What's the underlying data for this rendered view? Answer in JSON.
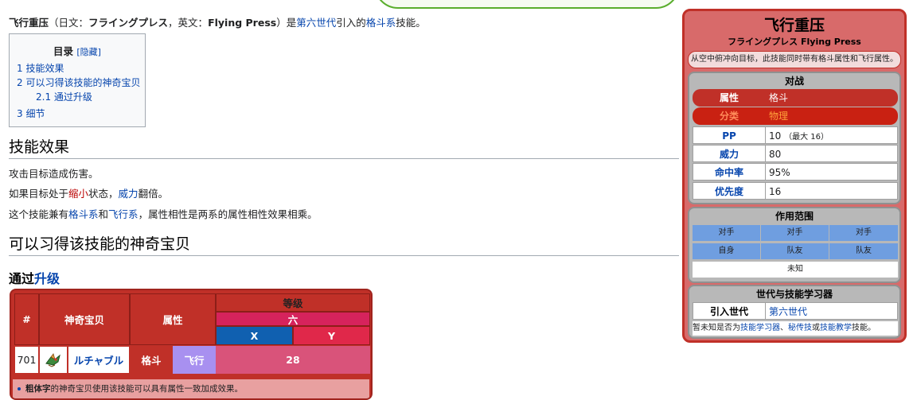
{
  "intro": {
    "title": "飞行重压",
    "paren_open": "（日文：",
    "jp_name": "フライングプレス",
    "en_label": "，英文：",
    "en_name": "Flying Press",
    "paren_close": "）是",
    "gen_link": "第六世代",
    "mid": "引入的",
    "type_link": "格斗系",
    "end": "技能。"
  },
  "toc": {
    "title": "目录",
    "toggle": "[隐藏]",
    "items": [
      "1 技能效果",
      "2 可以习得该技能的神奇宝贝",
      "2.1 通过升级",
      "3 细节"
    ]
  },
  "sections": {
    "effect_heading": "技能效果",
    "effect_p1": "攻击目标造成伤害。",
    "effect_p2_a": "如果目标处于",
    "effect_p2_link1": "缩小",
    "effect_p2_b": "状态，",
    "effect_p2_link2": "威力",
    "effect_p2_c": "翻倍。",
    "effect_p3_a": "这个技能兼有",
    "effect_p3_link1": "格斗系",
    "effect_p3_b": "和",
    "effect_p3_link2": "飞行系",
    "effect_p3_c": "，属性相性是两系的属性相性效果相乘。",
    "learn_heading": "可以习得该技能的神奇宝贝",
    "levelup_heading_a": "通过",
    "levelup_heading_link": "升级"
  },
  "learnset": {
    "headers": {
      "num": "#",
      "pokemon": "神奇宝贝",
      "type": "属性",
      "level": "等级",
      "gen": "六",
      "x": "X",
      "y": "Y"
    },
    "rows": [
      {
        "num": "701",
        "icon": "hawlucha-icon",
        "name": "ルチャブル",
        "type1": "格斗",
        "type2": "飞行",
        "level": "28"
      }
    ],
    "note_bold": "粗体字",
    "note_rest": "的神奇宝贝使用该技能可以具有属性一致加成效果。"
  },
  "infobox": {
    "title": "飞行重压",
    "jp": "フライングプレス",
    "en": "Flying Press",
    "desc": "从空中俯冲向目标，此技能同时带有格斗属性和飞行属性。",
    "battle_header": "对战",
    "type_label": "属性",
    "type_value": "格斗",
    "category_label": "分类",
    "category_value": "物理",
    "pp_label": "PP",
    "pp_value": "10",
    "pp_max": "（最大 16）",
    "power_label": "威力",
    "power_value": "80",
    "accuracy_label": "命中率",
    "accuracy_value": "95%",
    "priority_label": "优先度",
    "priority_value": "16",
    "range_header": "作用范围",
    "range_row1": [
      "对手",
      "对手",
      "对手"
    ],
    "range_row2": [
      "自身",
      "队友",
      "队友"
    ],
    "range_unknown": "未知",
    "gen_header": "世代与技能学习器",
    "intro_gen_label": "引入世代",
    "intro_gen_value": "第六世代",
    "tm_note_a": "暂未知是否为",
    "tm_link1": "技能学习器",
    "tm_sep": "、",
    "tm_link2": "秘传技",
    "tm_or": "或",
    "tm_link3": "技能教学",
    "tm_end": "技能。"
  },
  "colors": {
    "fighting": "#c03028",
    "flying": "#a890f0",
    "x_blue": "#1060b0",
    "y_red": "#e0284a",
    "link": "#0645ad"
  }
}
